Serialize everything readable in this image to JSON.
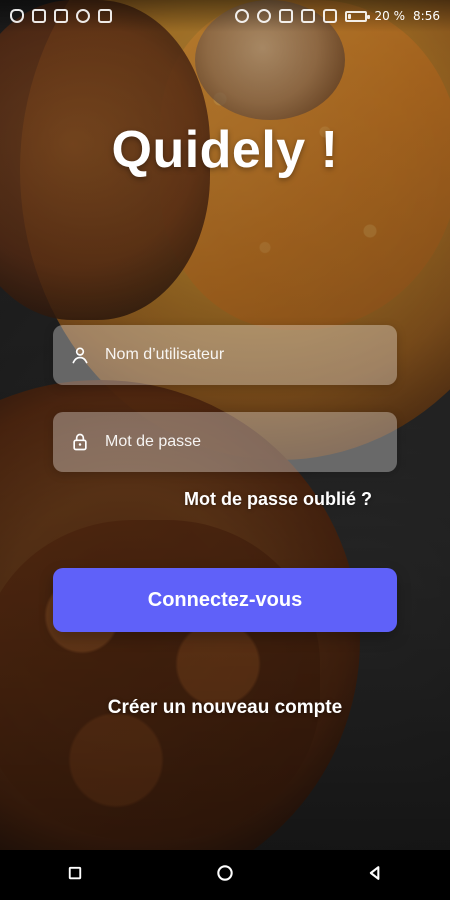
{
  "status_bar": {
    "battery_percent_text": "20 %",
    "time": "8:56",
    "battery_level": 0.2,
    "icons_left": [
      "shield-icon",
      "gmail-icon",
      "image-icon",
      "circle-app-icon",
      "photo-icon"
    ],
    "icons_right": [
      "alarm-icon",
      "wifi-icon",
      "signal-icon",
      "signal-icon",
      "charging-icon",
      "battery-icon"
    ]
  },
  "app": {
    "title": "Quidely !"
  },
  "login": {
    "username_placeholder": "Nom d’utilisateur",
    "password_placeholder": "Mot de passe",
    "forgot_password_label": "Mot de passe oublié ?",
    "submit_label": "Connectez-vous",
    "create_account_label": "Créer un nouveau compte"
  },
  "navigation": {
    "items": [
      "recent-apps",
      "home",
      "back"
    ]
  },
  "colors": {
    "primary": "#5F61F9",
    "navbar": "#000000",
    "text": "#FFFFFF"
  }
}
